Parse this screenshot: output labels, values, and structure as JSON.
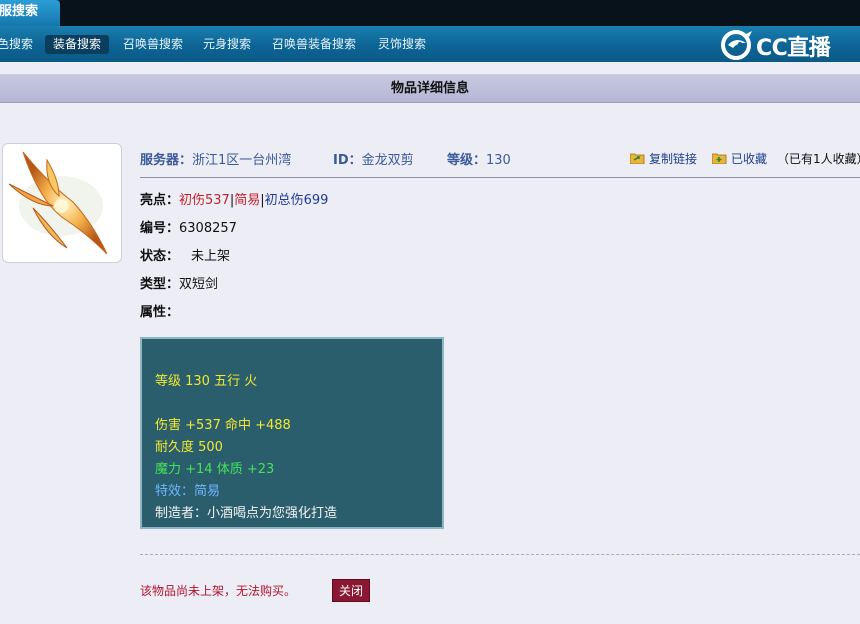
{
  "top_tab": {
    "label": "服搜索"
  },
  "nav": {
    "items": [
      {
        "label": "色搜索"
      },
      {
        "label": "装备搜索"
      },
      {
        "label": "召唤兽搜索"
      },
      {
        "label": "元身搜索"
      },
      {
        "label": "召唤兽装备搜索"
      },
      {
        "label": "灵饰搜索"
      }
    ],
    "active_index": 1
  },
  "logo": {
    "text": "CC直播"
  },
  "page_title": "物品详细信息",
  "info": {
    "server_label": "服务器：",
    "server_value": "浙江1区一台州湾",
    "id_label": "ID：",
    "id_value": "金龙双剪",
    "level_label": "等级：",
    "level_value": "130"
  },
  "actions": {
    "copy_link": "复制链接",
    "favorited": "已收藏",
    "favorite_count": "（已有1人收藏）"
  },
  "details": {
    "highlight_label": "亮点：",
    "highlight_parts": [
      "初伤537",
      "|",
      "简易",
      "|",
      "初总伤699"
    ],
    "serial_label": "编号：",
    "serial_value": "6308257",
    "status_label": "状态：",
    "status_value": "未上架",
    "type_label": "类型：",
    "type_value": "双短剑",
    "attr_label": "属性："
  },
  "attributes": {
    "level_line": "等级 130  五行 火",
    "damage_line": "伤害 +537  命中 +488",
    "durability_line": "耐久度 500",
    "magic_line": "魔力 +14  体质 +23",
    "effect_line": "特效：简易",
    "maker_line": "制造者：小酒喝点为您强化打造"
  },
  "footer": {
    "notice": "该物品尚未上架，无法购买。",
    "close_label": "关闭"
  },
  "colors": {
    "nav_bg": "#0c6495",
    "title_bar": "#b4b7d4",
    "attr_box": "#2b5e6c",
    "notice_red": "#b3142a",
    "close_btn": "#8a1832"
  }
}
